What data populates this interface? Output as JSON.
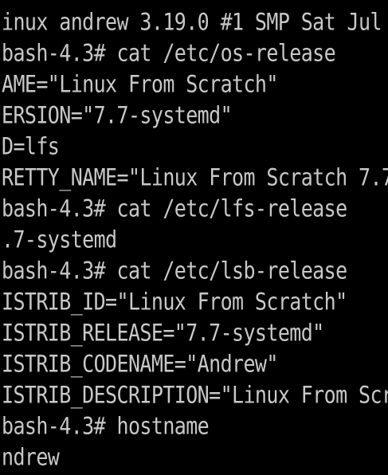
{
  "terminal": {
    "background": "#000000",
    "foreground": "#c8c8c8",
    "lines": [
      "inux andrew 3.19.0 #1 SMP Sat Jul",
      "bash-4.3# cat /etc/os-release",
      "AME=\"Linux From Scratch\"",
      "ERSION=\"7.7-systemd\"",
      "D=lfs",
      "RETTY_NAME=\"Linux From Scratch 7.7",
      "bash-4.3# cat /etc/lfs-release",
      ".7-systemd",
      "bash-4.3# cat /etc/lsb-release",
      "ISTRIB_ID=\"Linux From Scratch\"",
      "ISTRIB_RELEASE=\"7.7-systemd\"",
      "ISTRIB_CODENAME=\"Andrew\"",
      "ISTRIB_DESCRIPTION=\"Linux From Scr",
      "bash-4.3# hostname",
      "ndrew"
    ]
  }
}
